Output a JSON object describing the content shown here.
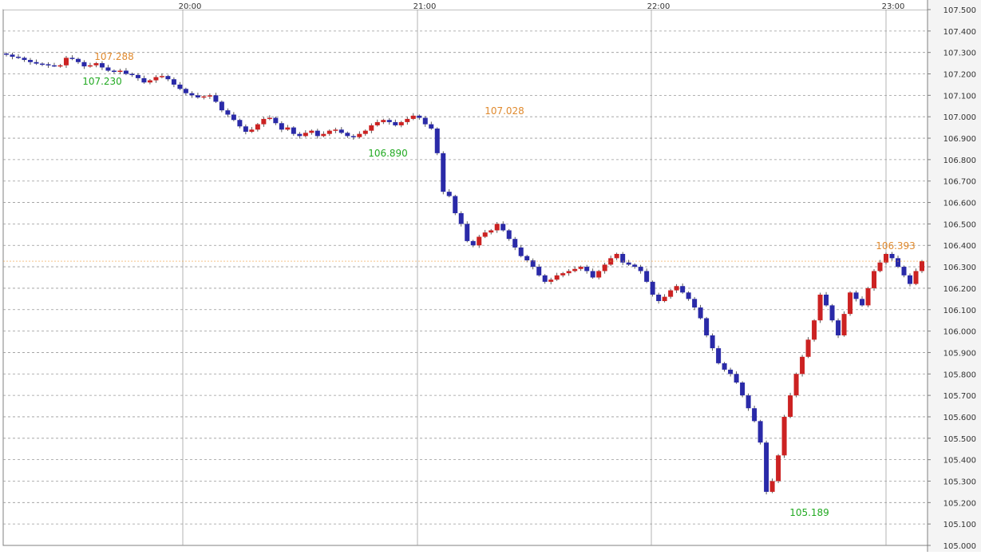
{
  "chart_data": {
    "type": "candlestick",
    "time_labels": [
      "20:00",
      "21:00",
      "22:00",
      "23:00"
    ],
    "y_ticks": [
      "107.500",
      "107.400",
      "107.300",
      "107.200",
      "107.100",
      "107.000",
      "106.900",
      "106.800",
      "106.700",
      "106.600",
      "106.500",
      "106.400",
      "106.300",
      "106.200",
      "106.100",
      "106.000",
      "105.900",
      "105.800",
      "105.700",
      "105.600",
      "105.500",
      "105.400",
      "105.300",
      "105.200",
      "105.100",
      "105.000"
    ],
    "ylim": [
      105.0,
      107.5
    ],
    "grid": true,
    "current_price": "106.326",
    "colors": {
      "up": "#cc2222",
      "down": "#2a2aa8",
      "high_label": "#e08a2e",
      "low_label": "#22aa22",
      "current_bg": "#f0a040",
      "grid": "#999999"
    },
    "annotations": [
      {
        "label": "107.288",
        "kind": "high",
        "time": "19:29",
        "price": 107.288
      },
      {
        "label": "107.230",
        "kind": "low",
        "time": "19:25",
        "price": 107.23
      },
      {
        "label": "106.890",
        "kind": "low",
        "time": "20:50",
        "price": 106.89
      },
      {
        "label": "107.028",
        "kind": "high",
        "time": "21:21",
        "price": 107.028
      },
      {
        "label": "106.393",
        "kind": "high",
        "time": "23:02",
        "price": 106.393
      },
      {
        "label": "105.189",
        "kind": "low",
        "time": "22:41",
        "price": 105.189
      }
    ],
    "path": [
      [
        "19:00",
        107.29
      ],
      [
        "19:03",
        107.28
      ],
      [
        "19:06",
        107.275
      ],
      [
        "19:09",
        107.265
      ],
      [
        "19:12",
        107.255
      ],
      [
        "19:15",
        107.248
      ],
      [
        "19:18",
        107.245
      ],
      [
        "19:21",
        107.24
      ],
      [
        "19:24",
        107.238
      ],
      [
        "19:27",
        107.24
      ],
      [
        "19:29",
        107.275
      ],
      [
        "19:32",
        107.27
      ],
      [
        "19:35",
        107.255
      ],
      [
        "19:38",
        107.235
      ],
      [
        "19:41",
        107.24
      ],
      [
        "19:44",
        107.25
      ],
      [
        "19:47",
        107.23
      ],
      [
        "19:50",
        107.215
      ],
      [
        "19:53",
        107.21
      ],
      [
        "19:56",
        107.215
      ],
      [
        "20:00",
        107.2
      ],
      [
        "20:03",
        107.195
      ],
      [
        "20:06",
        107.18
      ],
      [
        "20:09",
        107.16
      ],
      [
        "20:12",
        107.17
      ],
      [
        "20:15",
        107.185
      ],
      [
        "20:18",
        107.19
      ],
      [
        "20:21",
        107.175
      ],
      [
        "20:24",
        107.15
      ],
      [
        "20:27",
        107.13
      ],
      [
        "20:30",
        107.11
      ],
      [
        "20:33",
        107.1
      ],
      [
        "20:36",
        107.09
      ],
      [
        "20:39",
        107.095
      ],
      [
        "20:42",
        107.1
      ],
      [
        "20:45",
        107.07
      ],
      [
        "20:48",
        107.03
      ],
      [
        "20:51",
        107.01
      ],
      [
        "20:54",
        106.985
      ],
      [
        "20:57",
        106.955
      ],
      [
        "20:59",
        106.93
      ],
      [
        "21:02",
        106.94
      ],
      [
        "21:05",
        106.965
      ],
      [
        "21:08",
        106.99
      ],
      [
        "21:11",
        106.995
      ],
      [
        "21:14",
        106.97
      ],
      [
        "21:17",
        106.94
      ],
      [
        "21:20",
        106.95
      ],
      [
        "21:23",
        106.92
      ],
      [
        "21:26",
        106.91
      ],
      [
        "21:29",
        106.925
      ],
      [
        "21:32",
        106.935
      ],
      [
        "21:35",
        106.91
      ],
      [
        "21:38",
        106.92
      ],
      [
        "21:41",
        106.935
      ],
      [
        "21:44",
        106.94
      ],
      [
        "21:47",
        106.925
      ],
      [
        "21:50",
        106.91
      ],
      [
        "21:53",
        106.905
      ],
      [
        "21:56",
        106.92
      ],
      [
        "21:59",
        106.935
      ],
      [
        "22:02",
        106.96
      ],
      [
        "22:05",
        106.975
      ],
      [
        "22:08",
        106.985
      ],
      [
        "22:11",
        106.975
      ],
      [
        "22:14",
        106.96
      ],
      [
        "22:17",
        106.975
      ],
      [
        "22:20",
        106.99
      ],
      [
        "22:23",
        107.005
      ],
      [
        "22:26",
        106.995
      ],
      [
        "22:29",
        106.965
      ],
      [
        "22:32",
        106.945
      ],
      [
        "22:35",
        106.83
      ],
      [
        "22:38",
        106.65
      ],
      [
        "22:41",
        106.63
      ],
      [
        "22:44",
        106.55
      ],
      [
        "22:47",
        106.5
      ],
      [
        "22:50",
        106.42
      ],
      [
        "22:53",
        106.4
      ],
      [
        "22:56",
        106.44
      ],
      [
        "22:59",
        106.46
      ],
      [
        "23:02",
        106.47
      ],
      [
        "23:05",
        106.5
      ],
      [
        "23:08",
        106.47
      ],
      [
        "23:11",
        106.43
      ],
      [
        "23:14",
        106.39
      ],
      [
        "23:17",
        106.35
      ],
      [
        "23:20",
        106.33
      ],
      [
        "23:23",
        106.3
      ],
      [
        "23:26",
        106.26
      ],
      [
        "23:29",
        106.23
      ],
      [
        "23:32",
        106.24
      ],
      [
        "23:35",
        106.26
      ],
      [
        "23:38",
        106.27
      ],
      [
        "23:41",
        106.28
      ],
      [
        "23:44",
        106.29
      ],
      [
        "23:47",
        106.3
      ],
      [
        "23:50",
        106.28
      ],
      [
        "23:53",
        106.25
      ],
      [
        "23:56",
        106.28
      ],
      [
        "23:59",
        106.31
      ],
      [
        "00:02",
        106.34
      ],
      [
        "00:05",
        106.36
      ],
      [
        "00:08",
        106.32
      ],
      [
        "00:11",
        106.31
      ],
      [
        "00:14",
        106.3
      ],
      [
        "00:17",
        106.28
      ],
      [
        "00:20",
        106.23
      ],
      [
        "00:23",
        106.17
      ],
      [
        "00:26",
        106.14
      ],
      [
        "00:29",
        106.16
      ],
      [
        "00:32",
        106.19
      ],
      [
        "00:35",
        106.21
      ],
      [
        "00:38",
        106.18
      ],
      [
        "00:41",
        106.15
      ],
      [
        "00:44",
        106.11
      ],
      [
        "00:47",
        106.06
      ],
      [
        "00:50",
        105.98
      ],
      [
        "00:53",
        105.92
      ],
      [
        "00:56",
        105.85
      ],
      [
        "00:59",
        105.82
      ],
      [
        "01:02",
        105.8
      ],
      [
        "01:05",
        105.76
      ],
      [
        "01:08",
        105.7
      ],
      [
        "01:11",
        105.64
      ],
      [
        "01:14",
        105.58
      ],
      [
        "01:17",
        105.48
      ],
      [
        "01:20",
        105.25
      ],
      [
        "01:23",
        105.3
      ],
      [
        "01:26",
        105.42
      ],
      [
        "01:29",
        105.6
      ],
      [
        "01:32",
        105.7
      ],
      [
        "01:35",
        105.8
      ],
      [
        "01:38",
        105.88
      ],
      [
        "01:41",
        105.96
      ],
      [
        "01:44",
        106.05
      ],
      [
        "01:47",
        106.17
      ],
      [
        "01:50",
        106.12
      ],
      [
        "01:53",
        106.05
      ],
      [
        "01:56",
        105.98
      ],
      [
        "01:59",
        106.08
      ],
      [
        "02:02",
        106.18
      ],
      [
        "02:05",
        106.15
      ],
      [
        "02:08",
        106.12
      ],
      [
        "02:11",
        106.2
      ],
      [
        "02:14",
        106.28
      ],
      [
        "02:17",
        106.32
      ],
      [
        "02:20",
        106.36
      ],
      [
        "02:23",
        106.34
      ],
      [
        "02:26",
        106.3
      ],
      [
        "02:29",
        106.26
      ],
      [
        "02:32",
        106.22
      ],
      [
        "02:35",
        106.28
      ],
      [
        "02:38",
        106.326
      ]
    ]
  }
}
